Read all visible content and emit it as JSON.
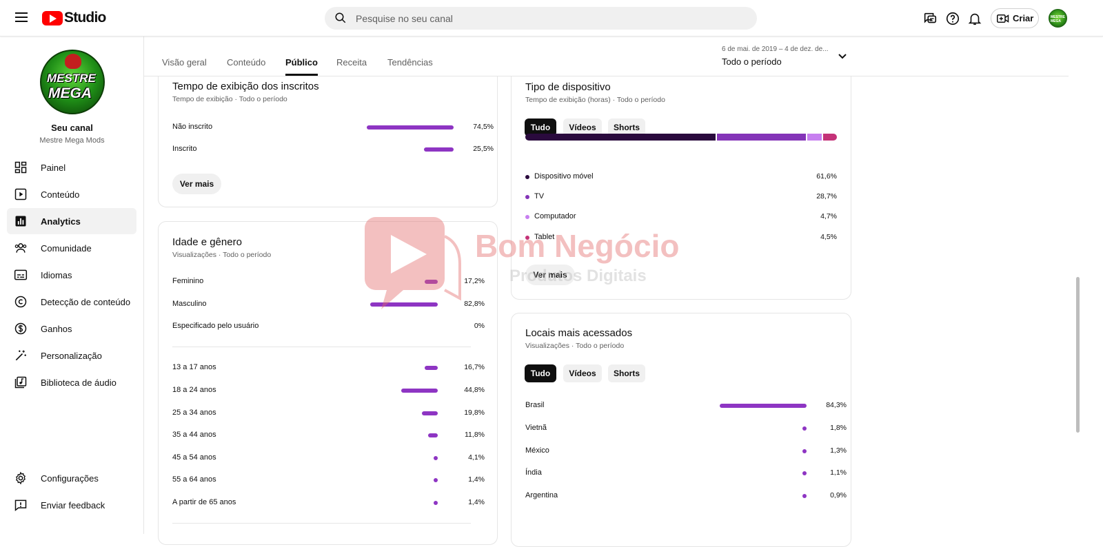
{
  "header": {
    "logo_text": "Studio",
    "search_placeholder": "Pesquise no seu canal",
    "create_label": "Criar",
    "avatar_text": "MESTRE MEGA"
  },
  "sidebar": {
    "avatar_line1": "MESTRE",
    "avatar_line2": "MEGA",
    "channel_label": "Seu canal",
    "channel_name": "Mestre Mega Mods",
    "items": [
      {
        "label": "Painel",
        "icon": "dashboard-icon"
      },
      {
        "label": "Conteúdo",
        "icon": "content-icon"
      },
      {
        "label": "Analytics",
        "icon": "analytics-icon"
      },
      {
        "label": "Comunidade",
        "icon": "community-icon"
      },
      {
        "label": "Idiomas",
        "icon": "subtitles-icon"
      },
      {
        "label": "Detecção de conteúdo",
        "icon": "copyright-icon"
      },
      {
        "label": "Ganhos",
        "icon": "dollar-icon"
      },
      {
        "label": "Personalização",
        "icon": "magic-wand-icon"
      },
      {
        "label": "Biblioteca de áudio",
        "icon": "audio-library-icon"
      }
    ],
    "bottom_items": [
      {
        "label": "Configurações",
        "icon": "gear-icon"
      },
      {
        "label": "Enviar feedback",
        "icon": "feedback-icon"
      }
    ]
  },
  "tabs": [
    "Visão geral",
    "Conteúdo",
    "Público",
    "Receita",
    "Tendências"
  ],
  "active_tab": "Público",
  "date_range": {
    "small": "6 de mai. de 2019 – 4 de dez. de...",
    "main": "Todo o período"
  },
  "subscribers_card": {
    "title": "Tempo de exibição dos inscritos",
    "subtitle": "Tempo de exibição · Todo o período",
    "rows": [
      {
        "label": "Não inscrito",
        "value": "74,5%",
        "pct": 74.5
      },
      {
        "label": "Inscrito",
        "value": "25,5%",
        "pct": 25.5
      }
    ],
    "more": "Ver mais"
  },
  "age_gender_card": {
    "title": "Idade e gênero",
    "subtitle": "Visualizações · Todo o período",
    "gender": [
      {
        "label": "Feminino",
        "value": "17,2%",
        "pct": 17.2
      },
      {
        "label": "Masculino",
        "value": "82,8%",
        "pct": 82.8
      },
      {
        "label": "Especificado pelo usuário",
        "value": "0%",
        "pct": 0
      }
    ],
    "ages": [
      {
        "label": "13 a 17 anos",
        "value": "16,7%",
        "pct": 16.7
      },
      {
        "label": "18 a 24 anos",
        "value": "44,8%",
        "pct": 44.8
      },
      {
        "label": "25 a 34 anos",
        "value": "19,8%",
        "pct": 19.8
      },
      {
        "label": "35 a 44 anos",
        "value": "11,8%",
        "pct": 11.8
      },
      {
        "label": "45 a 54 anos",
        "value": "4,1%",
        "pct": 4.1
      },
      {
        "label": "55 a 64 anos",
        "value": "1,4%",
        "pct": 1.4
      },
      {
        "label": "A partir de 65 anos",
        "value": "1,4%",
        "pct": 1.4
      }
    ]
  },
  "device_card": {
    "title": "Tipo de dispositivo",
    "subtitle": "Tempo de exibição (horas) · Todo o período",
    "chips": [
      "Tudo",
      "Vídeos",
      "Shorts"
    ],
    "rows": [
      {
        "label": "Dispositivo móvel",
        "value": "61,6%",
        "pct": 61.6,
        "color": "#2a0a3d"
      },
      {
        "label": "TV",
        "value": "28,7%",
        "pct": 28.7,
        "color": "#8434b8"
      },
      {
        "label": "Computador",
        "value": "4,7%",
        "pct": 4.7,
        "color": "#c77ff0"
      },
      {
        "label": "Tablet",
        "value": "4,5%",
        "pct": 4.5,
        "color": "#c43278"
      }
    ],
    "more": "Ver mais"
  },
  "locations_card": {
    "title": "Locais mais acessados",
    "subtitle": "Visualizações · Todo o período",
    "chips": [
      "Tudo",
      "Vídeos",
      "Shorts"
    ],
    "rows": [
      {
        "label": "Brasil",
        "value": "84,3%",
        "pct": 84.3
      },
      {
        "label": "Vietnã",
        "value": "1,8%",
        "pct": 1.8
      },
      {
        "label": "México",
        "value": "1,3%",
        "pct": 1.3
      },
      {
        "label": "Índia",
        "value": "1,1%",
        "pct": 1.1
      },
      {
        "label": "Argentina",
        "value": "0,9%",
        "pct": 0.9
      }
    ]
  },
  "watermark": {
    "line1": "Bom Negócio",
    "line2": "Produtos Digitais"
  },
  "colors": {
    "accent": "#8e35c3",
    "brand": "#ff0000"
  }
}
